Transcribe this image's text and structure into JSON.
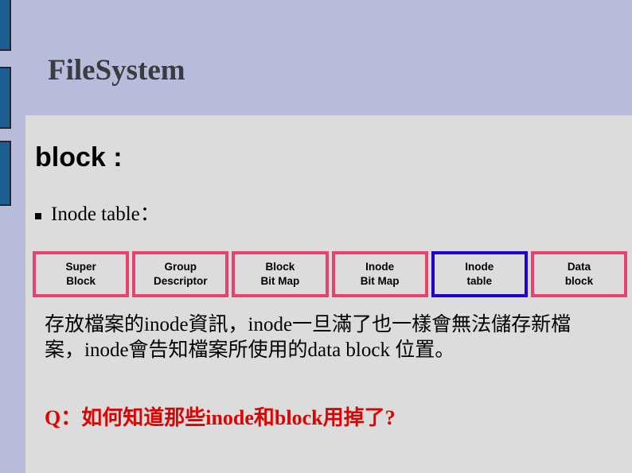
{
  "slide": {
    "title": "FileSystem",
    "background_color": "#b7bcdb",
    "panel_color": "#dcdcdc"
  },
  "decor": {
    "bar_color": "#1b5e92",
    "bar_outline": "#232733",
    "bars": [
      "side-bar-1",
      "side-bar-2",
      "side-bar-3"
    ]
  },
  "content": {
    "heading": "block :",
    "bullet": {
      "marker": "square-bullet-icon",
      "label": "Inode table："
    },
    "paragraph": "存放檔案的inode資訊，inode一旦滿了也一樣會無法儲存新檔案，inode會告知檔案所使用的data block 位置。",
    "question": "Q：如何知道那些inode和block用掉了?",
    "question_color": "#e00000"
  },
  "diagram": {
    "border_color": "#e8436f",
    "highlight_border_color": "#2200cc",
    "cells": [
      {
        "line1": "Super",
        "line2": "Block",
        "highlighted": false
      },
      {
        "line1": "Group",
        "line2": "Descriptor",
        "highlighted": false
      },
      {
        "line1": "Block",
        "line2": "Bit Map",
        "highlighted": false
      },
      {
        "line1": "Inode",
        "line2": "Bit Map",
        "highlighted": false
      },
      {
        "line1": "Inode",
        "line2": "table",
        "highlighted": true
      },
      {
        "line1": "Data",
        "line2": "block",
        "highlighted": false
      }
    ]
  }
}
